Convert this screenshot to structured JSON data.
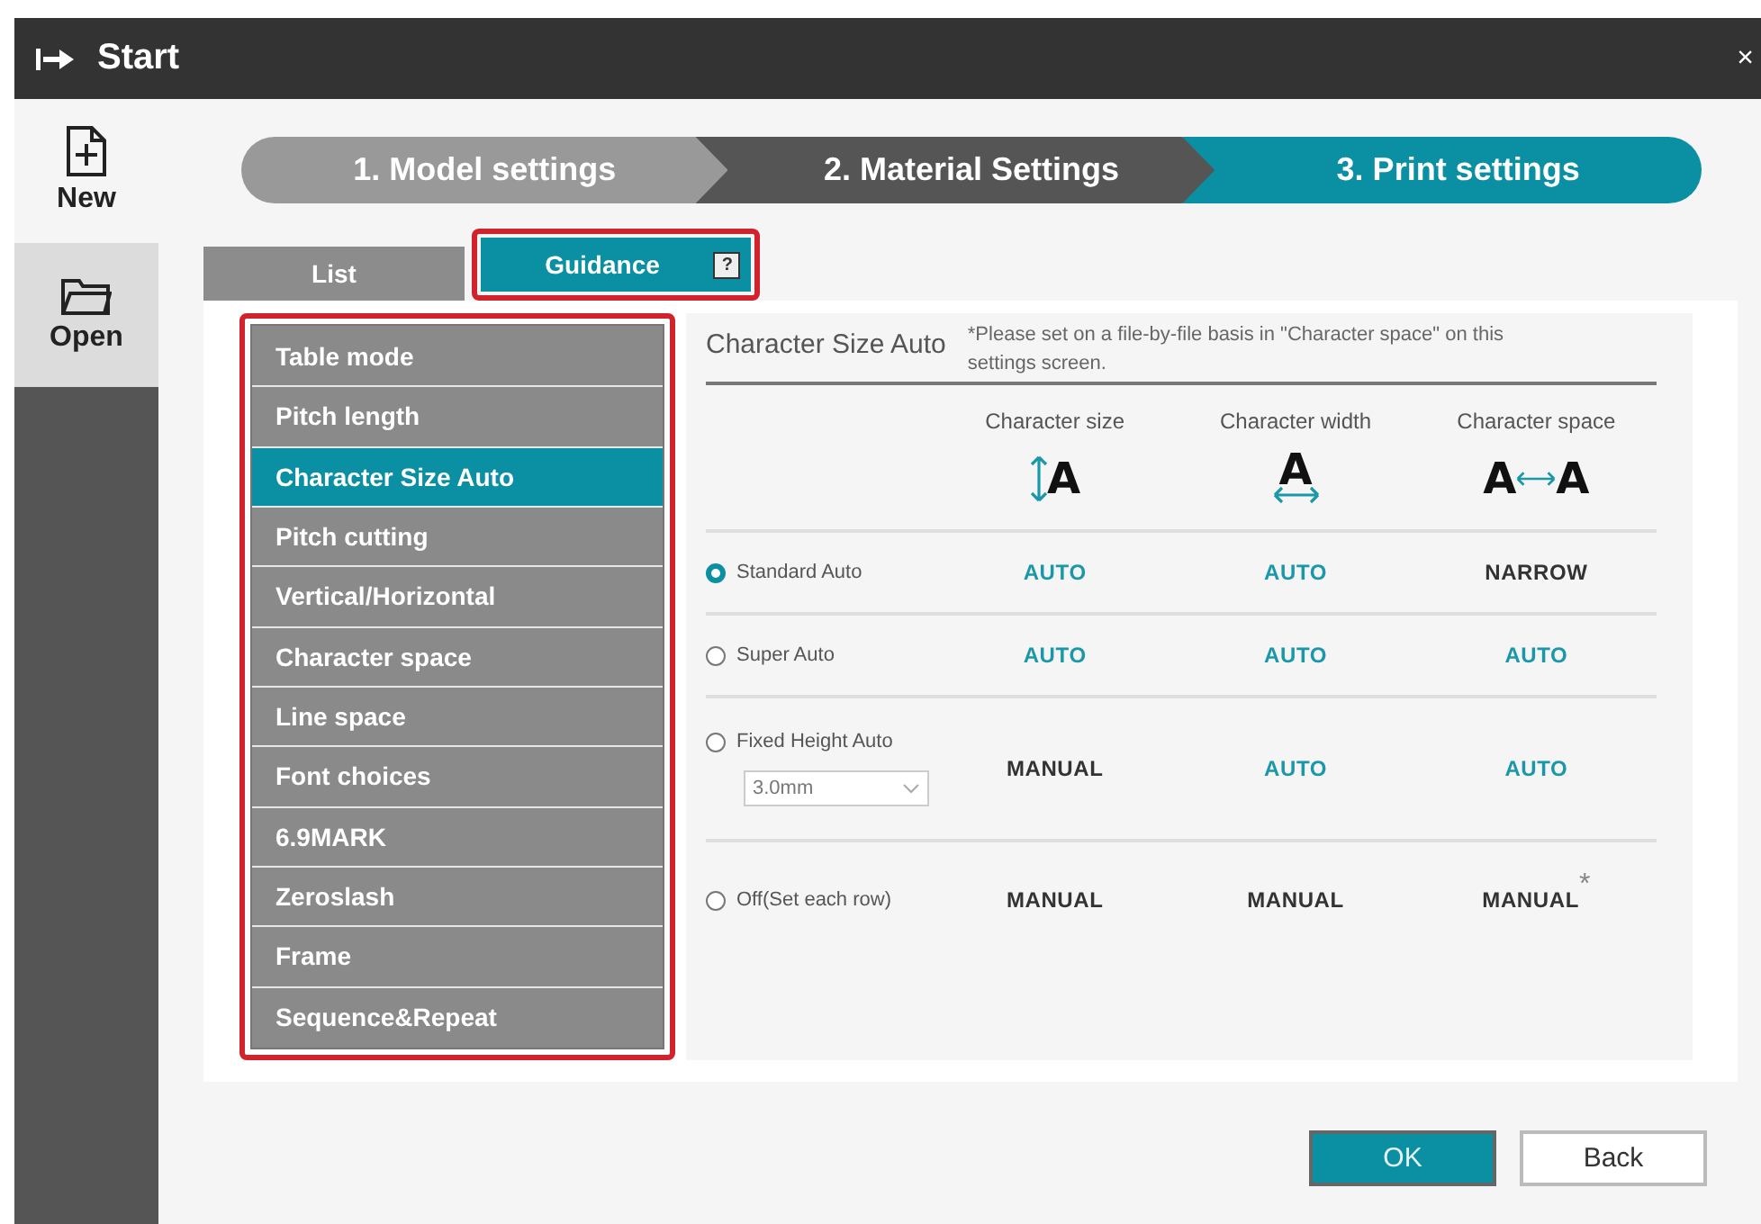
{
  "window": {
    "title": "Start",
    "close": "×"
  },
  "sidebar": {
    "items": [
      {
        "label": "New",
        "kind": "new",
        "selected": false
      },
      {
        "label": "Open",
        "kind": "open",
        "selected": true
      }
    ]
  },
  "steps": [
    {
      "label": "1. Model settings",
      "color": "#999999"
    },
    {
      "label": "2. Material Settings",
      "color": "#555555"
    },
    {
      "label": "3. Print settings",
      "color": "#0a8fa3"
    }
  ],
  "tabs": [
    {
      "label": "List",
      "selected": false
    },
    {
      "label": "Guidance",
      "selected": true,
      "help": "?"
    }
  ],
  "menu": {
    "items": [
      {
        "label": "Table mode",
        "selected": false
      },
      {
        "label": "Pitch length",
        "selected": false
      },
      {
        "label": "Character Size Auto",
        "selected": true
      },
      {
        "label": "Pitch cutting",
        "selected": false
      },
      {
        "label": "Vertical/Horizontal",
        "selected": false
      },
      {
        "label": "Character space",
        "selected": false
      },
      {
        "label": "Line space",
        "selected": false
      },
      {
        "label": "Font choices",
        "selected": false
      },
      {
        "label": "6.9MARK",
        "selected": false
      },
      {
        "label": "Zeroslash",
        "selected": false
      },
      {
        "label": "Frame",
        "selected": false
      },
      {
        "label": "Sequence&Repeat",
        "selected": false
      }
    ]
  },
  "guide": {
    "title": "Character Size Auto",
    "note": "*Please set on a file-by-file basis in \"Character space\" on this settings screen.",
    "columns": [
      {
        "label": "Character size",
        "kind": "height",
        "glyphs": [
          "A"
        ]
      },
      {
        "label": "Character width",
        "kind": "width",
        "glyphs": [
          "A"
        ]
      },
      {
        "label": "Character space",
        "kind": "space",
        "glyphs": [
          "A",
          "A"
        ]
      }
    ],
    "rows": [
      {
        "label": "Standard Auto",
        "selected": true,
        "cells": [
          {
            "text": "AUTO",
            "auto": true
          },
          {
            "text": "AUTO",
            "auto": true
          },
          {
            "text": "NARROW",
            "auto": false
          }
        ]
      },
      {
        "label": "Super Auto",
        "selected": false,
        "cells": [
          {
            "text": "AUTO",
            "auto": true
          },
          {
            "text": "AUTO",
            "auto": true
          },
          {
            "text": "AUTO",
            "auto": true
          }
        ]
      },
      {
        "label": "Fixed Height Auto",
        "selected": false,
        "dropdown": {
          "value": "3.0mm"
        },
        "cells": [
          {
            "text": "MANUAL",
            "auto": false
          },
          {
            "text": "AUTO",
            "auto": true
          },
          {
            "text": "AUTO",
            "auto": true
          }
        ]
      },
      {
        "label": "Off(Set each row)",
        "selected": false,
        "cells": [
          {
            "text": "MANUAL",
            "auto": false
          },
          {
            "text": "MANUAL",
            "auto": false
          },
          {
            "text": "MANUAL",
            "auto": false,
            "note": "*"
          }
        ]
      }
    ]
  },
  "buttons": [
    {
      "label": "OK",
      "kind": "primary"
    },
    {
      "label": "Back",
      "kind": "secondary"
    }
  ]
}
